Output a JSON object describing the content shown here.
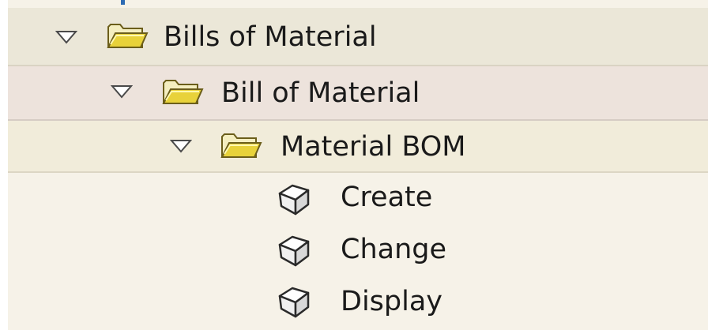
{
  "tree": {
    "nodes": [
      {
        "label": "Bills of Material",
        "type": "folder",
        "expanded": true,
        "level": 0,
        "icon": "folder-open-icon"
      },
      {
        "label": "Bill of Material",
        "type": "folder",
        "expanded": true,
        "level": 1,
        "icon": "folder-open-icon"
      },
      {
        "label": "Material BOM",
        "type": "folder",
        "expanded": true,
        "level": 2,
        "icon": "folder-open-icon"
      },
      {
        "label": "Create",
        "type": "transaction",
        "level": 3,
        "icon": "cube-icon"
      },
      {
        "label": "Change",
        "type": "transaction",
        "level": 3,
        "icon": "cube-icon"
      },
      {
        "label": "Display",
        "type": "transaction",
        "level": 3,
        "icon": "cube-icon"
      }
    ]
  },
  "colors": {
    "row_level0": "#ebe7d8",
    "row_level1": "#ede3dc",
    "row_level2": "#f1ecda",
    "row_leaf": "#f6f2e8",
    "folder_yellow": "#e8d23a"
  }
}
